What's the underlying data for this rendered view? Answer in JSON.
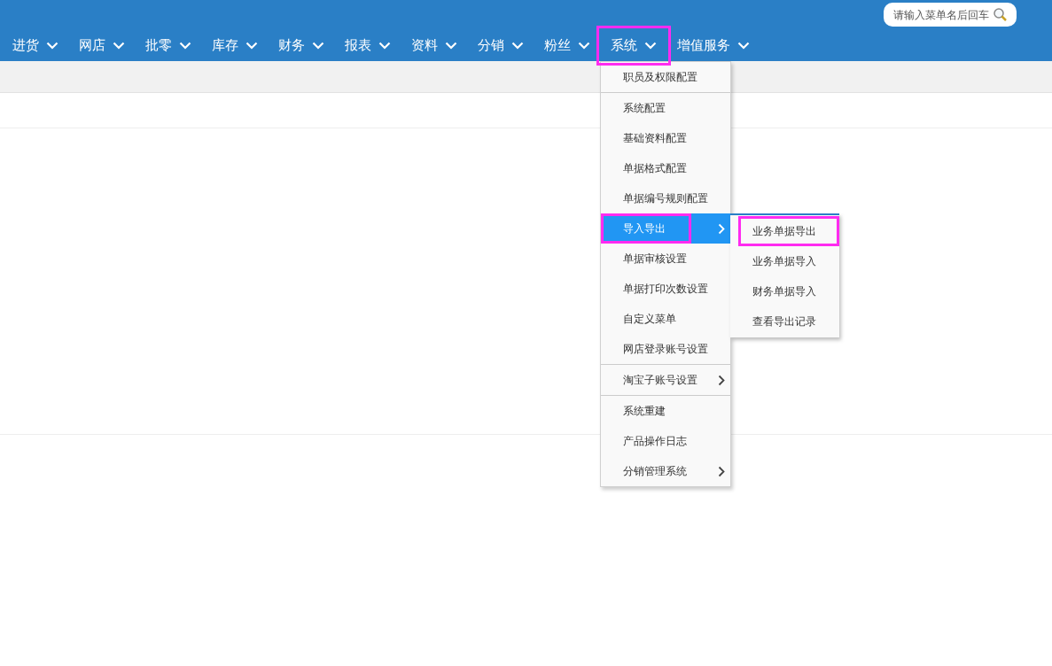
{
  "search": {
    "placeholder": "请输入菜单名后回车"
  },
  "nav": [
    {
      "label": "进货",
      "highlighted": false
    },
    {
      "label": "网店",
      "highlighted": false
    },
    {
      "label": "批零",
      "highlighted": false
    },
    {
      "label": "库存",
      "highlighted": false
    },
    {
      "label": "财务",
      "highlighted": false
    },
    {
      "label": "报表",
      "highlighted": false
    },
    {
      "label": "资料",
      "highlighted": false
    },
    {
      "label": "分销",
      "highlighted": false
    },
    {
      "label": "粉丝",
      "highlighted": false
    },
    {
      "label": "系统",
      "highlighted": true
    },
    {
      "label": "增值服务",
      "highlighted": false
    }
  ],
  "menu_groups": [
    [
      {
        "label": "职员及权限配置",
        "has_submenu": false,
        "selected": false,
        "highlighted": false
      }
    ],
    [
      {
        "label": "系统配置",
        "has_submenu": false,
        "selected": false,
        "highlighted": false
      },
      {
        "label": "基础资料配置",
        "has_submenu": false,
        "selected": false,
        "highlighted": false
      },
      {
        "label": "单据格式配置",
        "has_submenu": false,
        "selected": false,
        "highlighted": false
      },
      {
        "label": "单据编号规则配置",
        "has_submenu": false,
        "selected": false,
        "highlighted": false
      },
      {
        "label": "导入导出",
        "has_submenu": true,
        "selected": true,
        "highlighted": true
      },
      {
        "label": "单据审核设置",
        "has_submenu": false,
        "selected": false,
        "highlighted": false
      },
      {
        "label": "单据打印次数设置",
        "has_submenu": false,
        "selected": false,
        "highlighted": false
      },
      {
        "label": "自定义菜单",
        "has_submenu": false,
        "selected": false,
        "highlighted": false
      },
      {
        "label": "网店登录账号设置",
        "has_submenu": false,
        "selected": false,
        "highlighted": false
      }
    ],
    [
      {
        "label": "淘宝子账号设置",
        "has_submenu": true,
        "selected": false,
        "highlighted": false
      }
    ],
    [
      {
        "label": "系统重建",
        "has_submenu": false,
        "selected": false,
        "highlighted": false
      },
      {
        "label": "产品操作日志",
        "has_submenu": false,
        "selected": false,
        "highlighted": false
      },
      {
        "label": "分销管理系统",
        "has_submenu": true,
        "selected": false,
        "highlighted": false
      }
    ]
  ],
  "submenu": [
    {
      "label": "业务单据导出",
      "highlighted": true
    },
    {
      "label": "业务单据导入",
      "highlighted": false
    },
    {
      "label": "财务单据导入",
      "highlighted": false
    },
    {
      "label": "查看导出记录",
      "highlighted": false
    }
  ]
}
